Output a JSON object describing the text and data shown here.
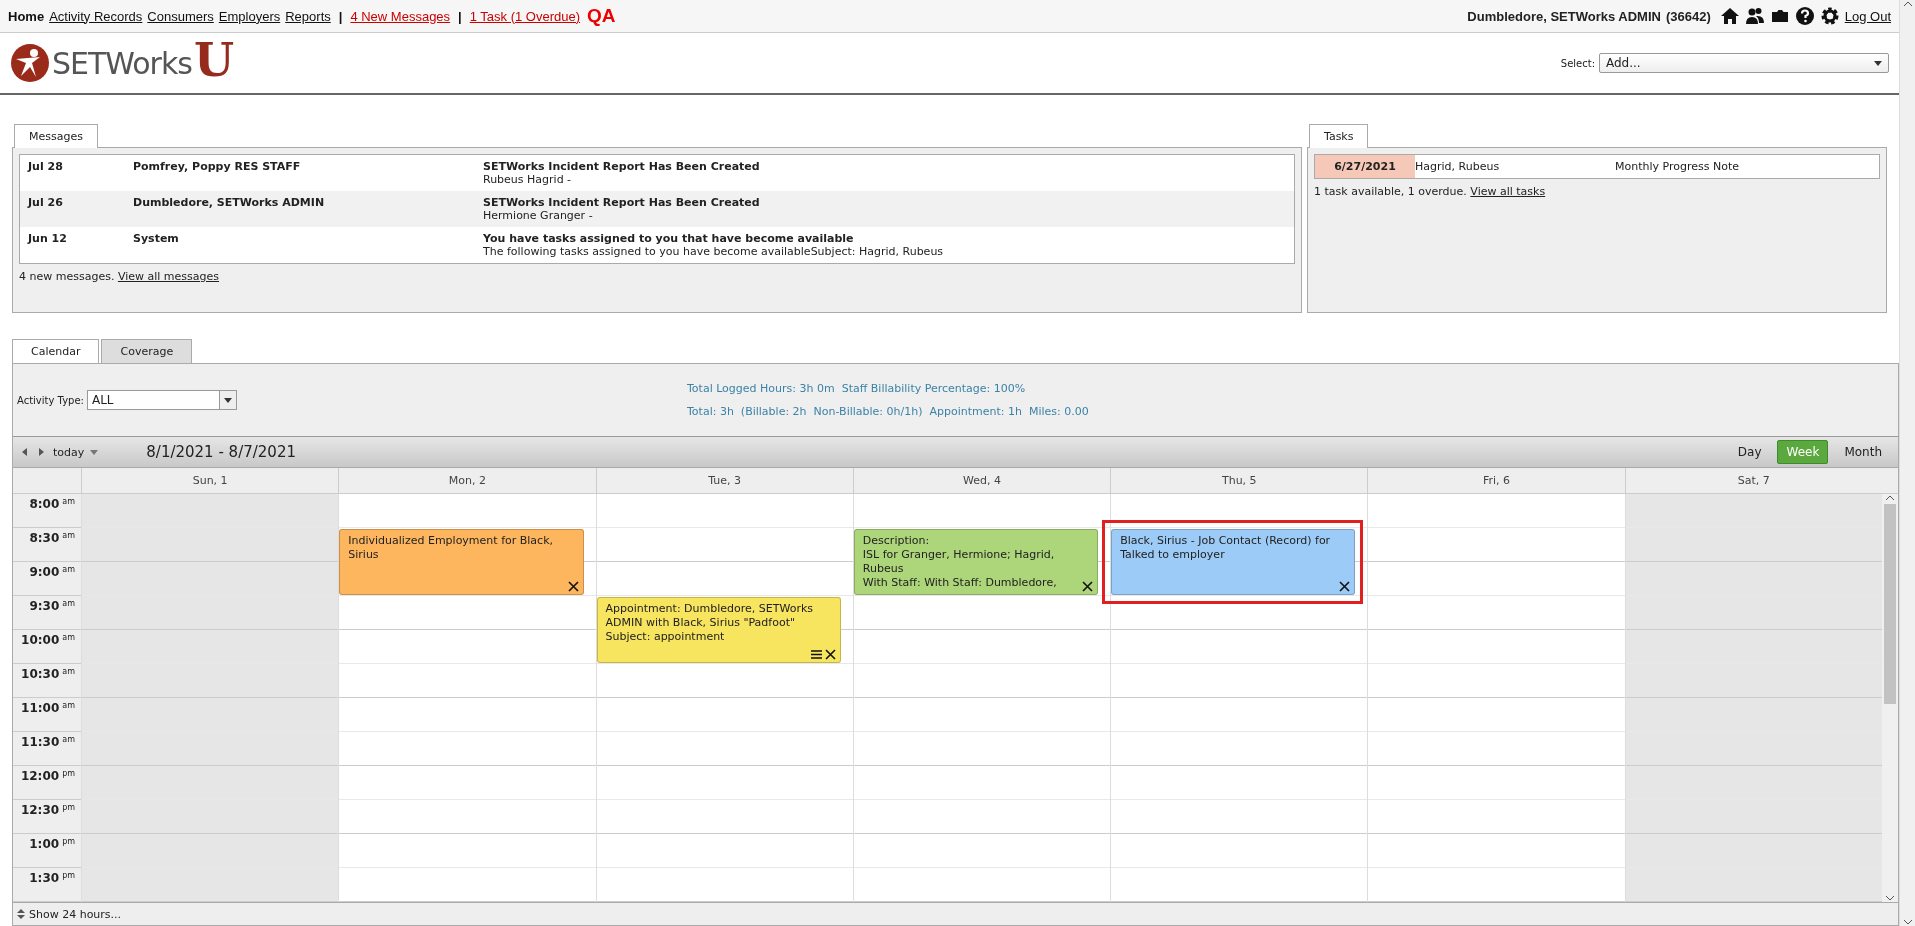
{
  "top_nav": {
    "items": [
      {
        "label": "Home",
        "kind": "current"
      },
      {
        "label": "Activity Records",
        "kind": "link"
      },
      {
        "label": "Consumers",
        "kind": "link"
      },
      {
        "label": "Employers",
        "kind": "link"
      },
      {
        "label": "Reports",
        "kind": "link"
      },
      {
        "label": "|",
        "kind": "separator"
      },
      {
        "label": "4 New Messages",
        "kind": "alert"
      },
      {
        "label": "|",
        "kind": "separator"
      },
      {
        "label": "1 Task (1 Overdue)",
        "kind": "alert"
      }
    ],
    "env_badge": "QA",
    "user": "Dumbledore, SETWorks ADMIN",
    "user_id": "(36642)",
    "logout": "Log Out"
  },
  "logo": {
    "brand": "SETWorks",
    "mark": "U"
  },
  "select": {
    "label": "Select:",
    "value": "Add..."
  },
  "messages": {
    "tab": "Messages",
    "rows": [
      {
        "date": "Jul 28",
        "sender": "Pomfrey, Poppy RES STAFF",
        "subject": "SETWorks Incident Report Has Been Created",
        "body": "Rubeus Hagrid -"
      },
      {
        "date": "Jul 26",
        "sender": "Dumbledore, SETWorks ADMIN",
        "subject": "SETWorks Incident Report Has Been Created",
        "body": "Hermione Granger -"
      },
      {
        "date": "Jun 12",
        "sender": "System",
        "subject": "You have tasks assigned to you that have become available",
        "body": "The following tasks assigned to you have become availableSubject: Hagrid, Rubeus"
      }
    ],
    "summary": "4 new messages.",
    "link": "View all messages"
  },
  "tasks": {
    "tab": "Tasks",
    "rows": [
      {
        "date": "6/27/2021",
        "overdue": true,
        "name": "Hagrid, Rubeus",
        "title": "Monthly Progress Note"
      }
    ],
    "summary": "1 task available, 1 overdue.",
    "link": "View all tasks"
  },
  "calendar_tabs": [
    {
      "label": "Calendar",
      "selected": true
    },
    {
      "label": "Coverage",
      "selected": false
    }
  ],
  "filter": {
    "label": "Activity Type:",
    "value": "ALL"
  },
  "stats": [
    "Total Logged Hours: 3h 0m  Staff Billability Percentage: 100%",
    "Total: 3h  (Billable: 2h  Non-Billable: 0h/1h)  Appointment: 1h  Miles: 0.00"
  ],
  "nav": {
    "today": "today",
    "range": "8/1/2021 - 8/7/2021",
    "views": [
      {
        "label": "Day",
        "selected": false
      },
      {
        "label": "Week",
        "selected": true
      },
      {
        "label": "Month",
        "selected": false
      }
    ]
  },
  "days": [
    {
      "label": "Sun, 1",
      "weekend": true
    },
    {
      "label": "Mon, 2",
      "weekend": false
    },
    {
      "label": "Tue, 3",
      "weekend": false
    },
    {
      "label": "Wed, 4",
      "weekend": false
    },
    {
      "label": "Thu, 5",
      "weekend": false
    },
    {
      "label": "Fri, 6",
      "weekend": false
    },
    {
      "label": "Sat, 7",
      "weekend": true
    }
  ],
  "times": [
    {
      "time": "8:00",
      "period": "am"
    },
    {
      "time": "8:30",
      "period": "am"
    },
    {
      "time": "9:00",
      "period": "am"
    },
    {
      "time": "9:30",
      "period": "am"
    },
    {
      "time": "10:00",
      "period": "am"
    },
    {
      "time": "10:30",
      "period": "am"
    },
    {
      "time": "11:00",
      "period": "am"
    },
    {
      "time": "11:30",
      "period": "am"
    },
    {
      "time": "12:00",
      "period": "pm"
    },
    {
      "time": "12:30",
      "period": "pm"
    },
    {
      "time": "1:00",
      "period": "pm"
    },
    {
      "time": "1:30",
      "period": "pm"
    }
  ],
  "events": [
    {
      "lines": [
        "Individualized Employment for Black, Sirius"
      ],
      "color": "#fdb55e",
      "menu": false,
      "highlighted": false
    },
    {
      "lines": [
        "Appointment: Dumbledore, SETWorks ADMIN with Black, Sirius \"Padfoot\"",
        "Subject: appointment"
      ],
      "color": "#f7e45f",
      "menu": true,
      "highlighted": false
    },
    {
      "lines": [
        "Description:",
        "ISL for Granger, Hermione; Hagrid, Rubeus",
        "With Staff: With Staff: Dumbledore,"
      ],
      "color": "#add67a",
      "menu": false,
      "highlighted": false
    },
    {
      "lines": [
        "Black, Sirius - Job Contact (Record) for Talked to employer"
      ],
      "color": "#9ccbf7",
      "menu": false,
      "highlighted": true
    }
  ],
  "footer": "Show 24 hours..."
}
